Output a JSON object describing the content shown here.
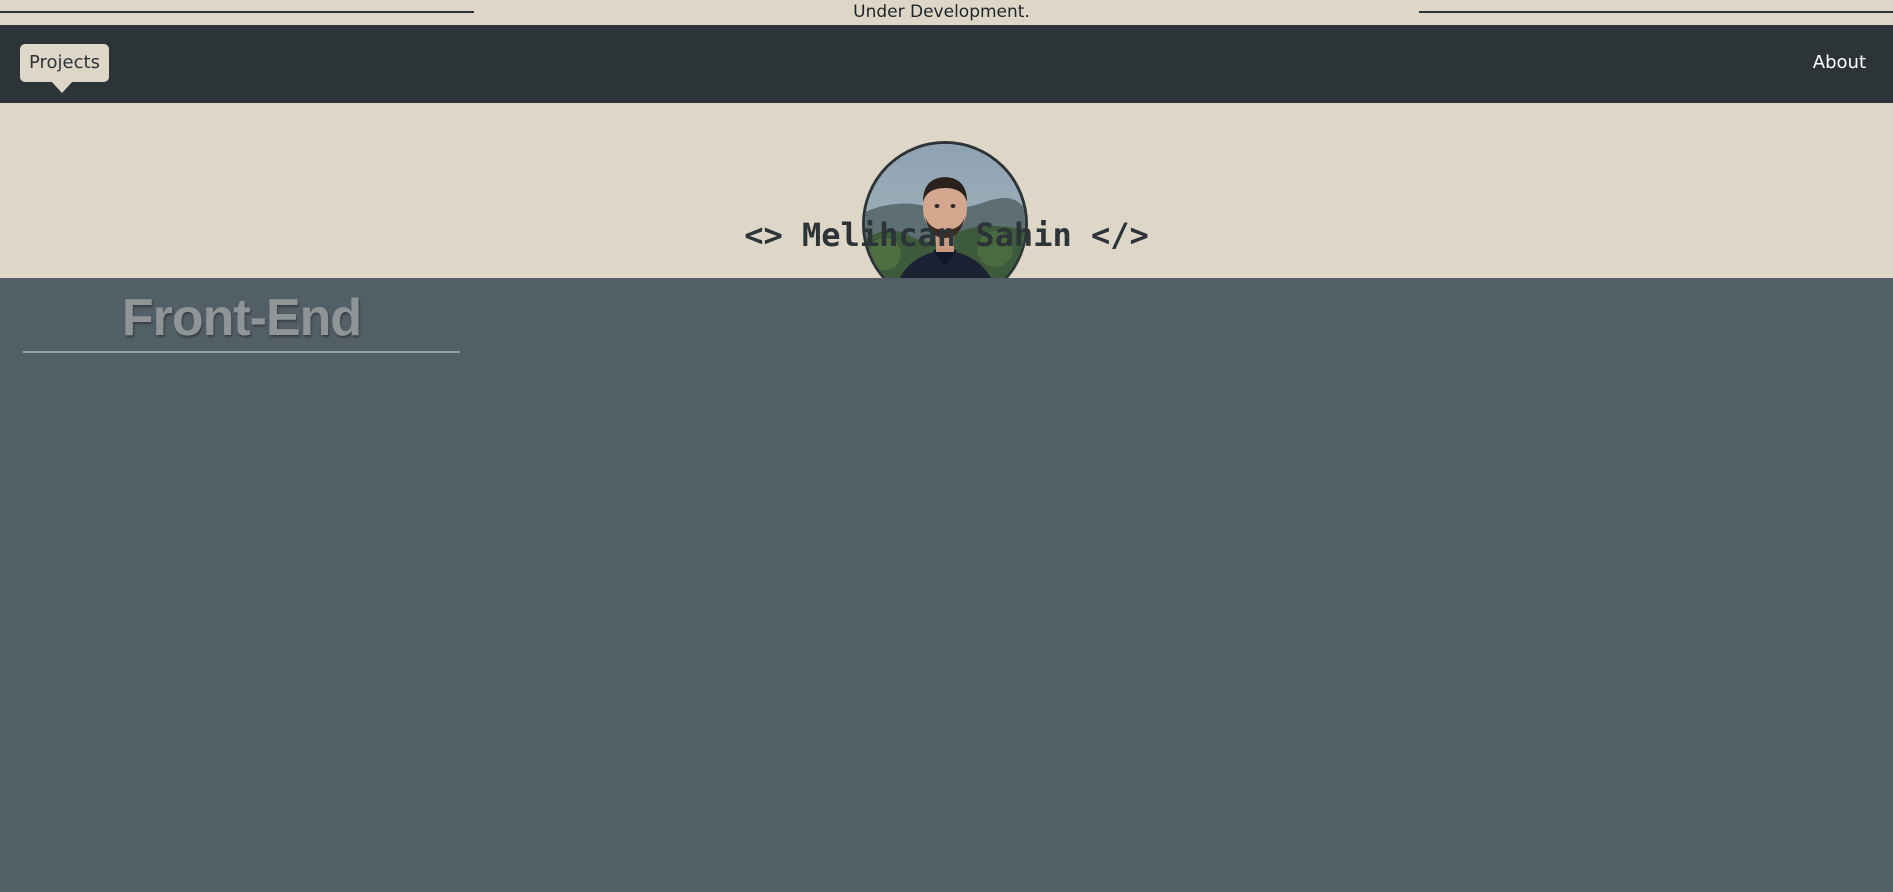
{
  "banner": {
    "notice": "Under Development."
  },
  "nav": {
    "projects_label": "Projects",
    "about_label": "About"
  },
  "profile": {
    "name": "<> Melihcan Sahin </>"
  },
  "section": {
    "title": "Front-End"
  },
  "colors": {
    "cream": "#ded7c8",
    "dark": "#2c3438",
    "slate": "#535f66"
  }
}
